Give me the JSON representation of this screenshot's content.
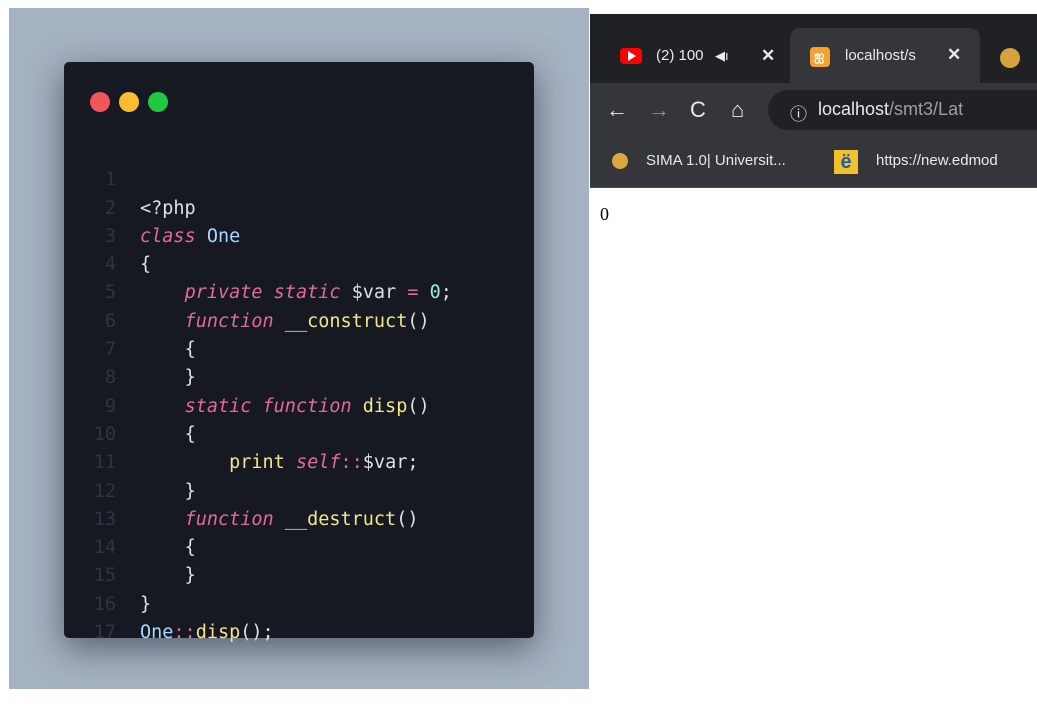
{
  "code_window": {
    "dot_colors": [
      "#f2555a",
      "#f9bd2e",
      "#1fca42"
    ],
    "line_numbers": [
      "1",
      "2",
      "3",
      "4",
      "5",
      "6",
      "7",
      "8",
      "9",
      "10",
      "11",
      "12",
      "13",
      "14",
      "15",
      "16",
      "17"
    ],
    "tokens": {
      "l1": "<?php",
      "l2_kw": "class",
      "l2_cls": "One",
      "l3": "{",
      "l4_kw": "private static",
      "l4_var": "$var",
      "l4_eq": "=",
      "l4_num": "0",
      "l4_semi": ";",
      "l5_kw": "function",
      "l5_fn": "__construct",
      "l5_paren": "()",
      "l6": "{",
      "l7": "}",
      "l8_kw": "static function",
      "l8_fn": "disp",
      "l8_paren": "()",
      "l9": "{",
      "l10_fn": "print",
      "l10_kw": "self",
      "l10_op": "::",
      "l10_var": "$var;",
      "l11": "}",
      "l12_kw": "function",
      "l12_fn": "__destruct",
      "l12_paren": "()",
      "l13": "{",
      "l14": "}",
      "l15": "}",
      "l16_cls": "One",
      "l16_op": "::",
      "l16_fn": "disp",
      "l16_end": "();"
    }
  },
  "browser": {
    "tabs": [
      {
        "title": "(2) 100",
        "icon": "youtube-icon",
        "audio": "◀ı",
        "close": "✕"
      },
      {
        "title": "localhost/s",
        "icon": "xampp-icon",
        "close": "✕"
      },
      {
        "title": "",
        "icon": "sima-icon"
      }
    ],
    "toolbar": {
      "back": "←",
      "forward": "→",
      "reload": "C",
      "home": "⌂",
      "info": "ⓘ",
      "url_host": "localhost",
      "url_path": "/smt3/Lat"
    },
    "bookmarks": [
      {
        "label": "SIMA 1.0| Universit...",
        "icon": "sima-icon"
      },
      {
        "label": "https://new.edmod",
        "icon": "edmodo-icon",
        "glyph": "ë"
      }
    ],
    "page_output": "0"
  }
}
